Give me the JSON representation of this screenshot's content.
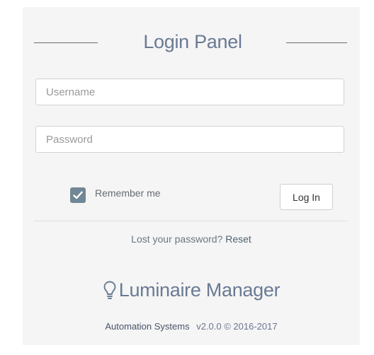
{
  "panel": {
    "title": "Login Panel"
  },
  "form": {
    "username_placeholder": "Username",
    "username_value": "",
    "password_placeholder": "Password",
    "password_value": "",
    "remember_label": "Remember me",
    "remember_checked": true,
    "login_label": "Log In"
  },
  "recovery": {
    "text": "Lost your password?",
    "link_label": "Reset"
  },
  "brand": {
    "icon": "lightbulb-icon",
    "name": "Luminaire Manager"
  },
  "footer": {
    "company": "Automation Systems",
    "version": "v2.0.0 © 2016-2017"
  },
  "colors": {
    "accent": "#6a7a94",
    "checkbox": "#718795",
    "panel_bg": "#f5f5f5"
  }
}
